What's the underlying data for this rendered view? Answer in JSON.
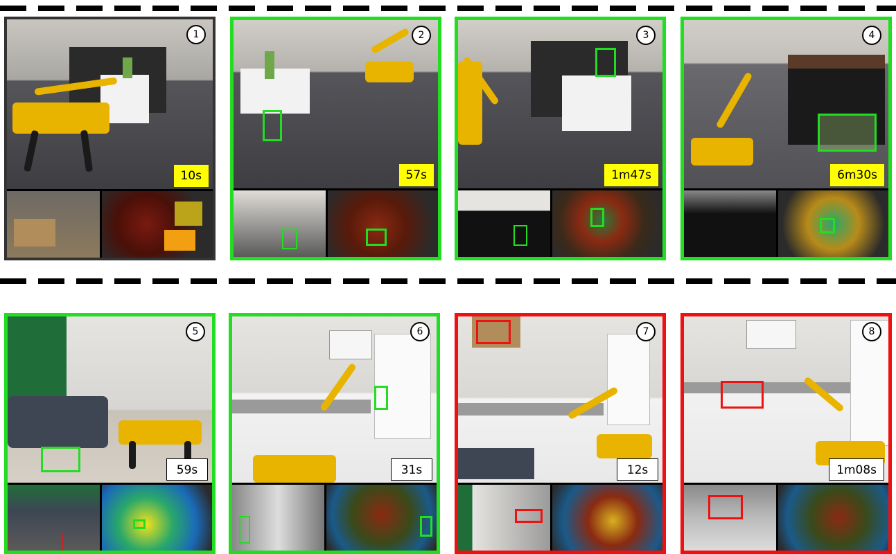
{
  "panels": [
    {
      "num": "1",
      "time": "10s",
      "frame": "#333333",
      "label_bg": "#ffff00",
      "box": ""
    },
    {
      "num": "2",
      "time": "57s",
      "frame": "#22dd22",
      "label_bg": "#ffff00",
      "box": "#22dd22"
    },
    {
      "num": "3",
      "time": "1m47s",
      "frame": "#22dd22",
      "label_bg": "#ffff00",
      "box": "#22dd22"
    },
    {
      "num": "4",
      "time": "6m30s",
      "frame": "#22dd22",
      "label_bg": "#ffff00",
      "box": "#22dd22"
    },
    {
      "num": "5",
      "time": "59s",
      "frame": "#22dd22",
      "label_bg": "#ffffff",
      "box": "#22dd22"
    },
    {
      "num": "6",
      "time": "31s",
      "frame": "#22dd22",
      "label_bg": "#ffffff",
      "box": "#22dd22"
    },
    {
      "num": "7",
      "time": "12s",
      "frame": "#ee1111",
      "label_bg": "#ffffff",
      "box": "#ee1111"
    },
    {
      "num": "8",
      "time": "1m08s",
      "frame": "#ee1111",
      "label_bg": "#ffffff",
      "box": "#ee1111"
    }
  ]
}
